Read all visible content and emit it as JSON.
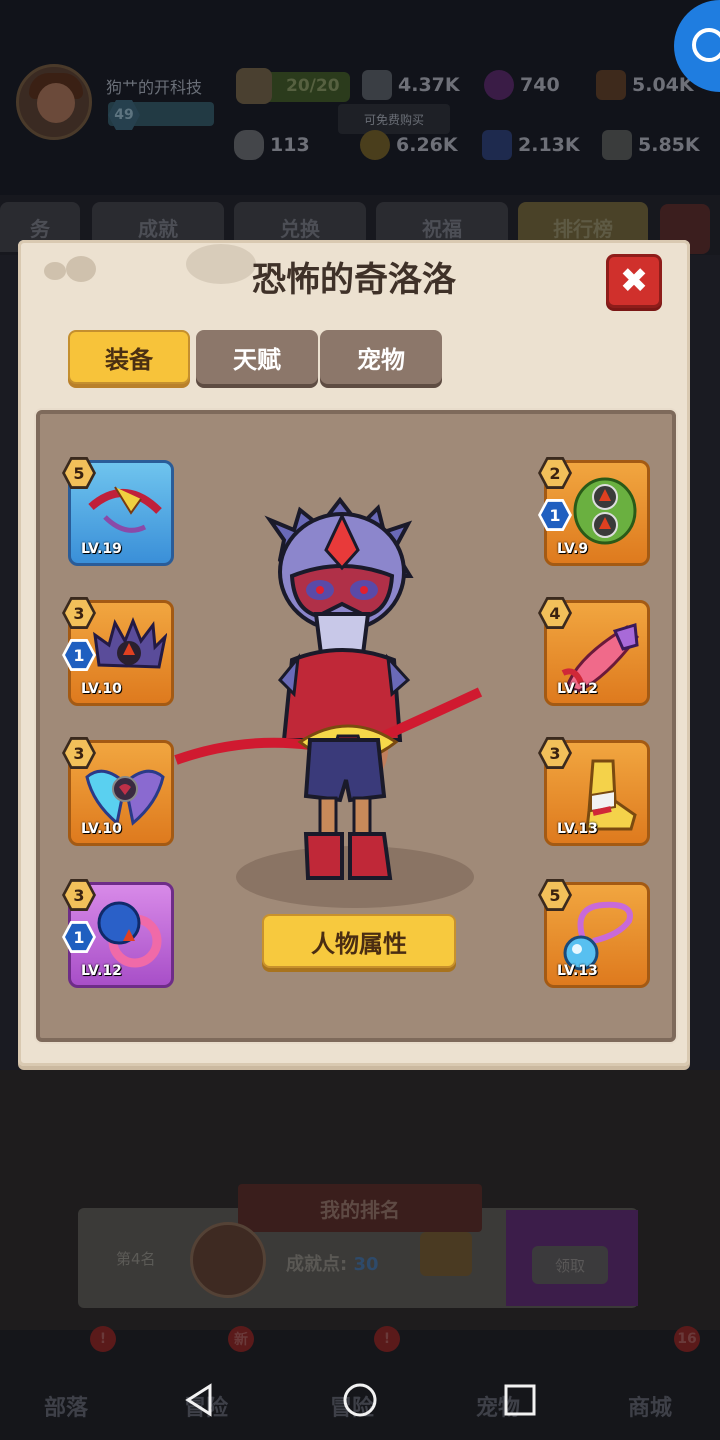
{
  "header": {
    "player_name": "狗艹的开科技",
    "level": "49",
    "energy": "20/20",
    "free_buy_tag": "可免费购买",
    "resources_row1": [
      {
        "icon": "gem-pile-icon",
        "value": "4.37K"
      },
      {
        "icon": "purple-orb-icon",
        "value": "740"
      },
      {
        "icon": "wood-icon",
        "value": "5.04K"
      }
    ],
    "resources_row2": [
      {
        "icon": "bone-icon",
        "value": "113"
      },
      {
        "icon": "coin-icon",
        "value": "6.26K"
      },
      {
        "icon": "crystal-icon",
        "value": "2.13K"
      },
      {
        "icon": "stone-icon",
        "value": "5.85K"
      }
    ]
  },
  "background_tabs": [
    "务",
    "成就",
    "兑换",
    "祝福",
    "排行榜"
  ],
  "modal": {
    "title": "恐怖的奇洛洛",
    "close_symbol": "✖",
    "tabs": [
      "装备",
      "天赋",
      "宠物"
    ],
    "active_tab": "装备",
    "attributes_button": "人物属性",
    "left_slots": [
      {
        "star": "5",
        "gem": null,
        "level": "LV.19",
        "rarity": "blue",
        "icon": "bow-weapon-icon"
      },
      {
        "star": "3",
        "gem": "1",
        "level": "LV.10",
        "rarity": "orange",
        "icon": "spiked-helmet-icon"
      },
      {
        "star": "3",
        "gem": null,
        "level": "LV.10",
        "rarity": "orange",
        "icon": "wing-armor-icon"
      },
      {
        "star": "3",
        "gem": "1",
        "level": "LV.12",
        "rarity": "purple",
        "icon": "ring-icon"
      }
    ],
    "right_slots": [
      {
        "star": "2",
        "gem": "1",
        "level": "LV.9",
        "rarity": "orange",
        "icon": "shield-icon"
      },
      {
        "star": "4",
        "gem": null,
        "level": "LV.12",
        "rarity": "orange",
        "icon": "gauntlet-icon"
      },
      {
        "star": "3",
        "gem": null,
        "level": "LV.13",
        "rarity": "orange",
        "icon": "boot-icon"
      },
      {
        "star": "5",
        "gem": null,
        "level": "LV.13",
        "rarity": "orange",
        "icon": "necklace-icon"
      }
    ]
  },
  "my_rank": {
    "banner": "我的排名",
    "position": "第4名",
    "points_label": "成就点:",
    "points_value": "30",
    "claim": "领取"
  },
  "bottom_nav": [
    {
      "label": "部落",
      "badge": "!"
    },
    {
      "label": "冒险",
      "badge": "新"
    },
    {
      "label": "冒险",
      "badge": "!"
    },
    {
      "label": "宠物",
      "badge": null
    },
    {
      "label": "商城",
      "badge": "16"
    }
  ],
  "colors": {
    "accent_gold": "#f7c33a",
    "close_red": "#d0302c",
    "panel": "#ece1d0",
    "inner_panel": "#a08a78"
  }
}
